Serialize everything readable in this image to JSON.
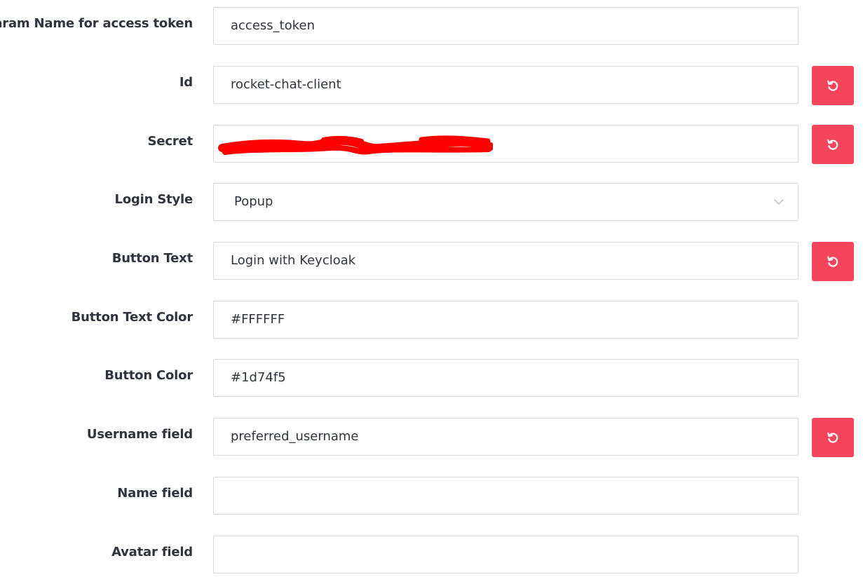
{
  "fields": {
    "param_name": {
      "label": "Param Name for access token",
      "value": "access_token"
    },
    "id": {
      "label": "Id",
      "value": "rocket-chat-client"
    },
    "secret": {
      "label": "Secret",
      "value": "",
      "redacted": true
    },
    "login_style": {
      "label": "Login Style",
      "value": "Popup"
    },
    "button_text": {
      "label": "Button Text",
      "value": "Login with Keycloak"
    },
    "button_text_color": {
      "label": "Button Text Color",
      "value": "#FFFFFF"
    },
    "button_color": {
      "label": "Button Color",
      "value": "#1d74f5"
    },
    "username_field": {
      "label": "Username field",
      "value": "preferred_username"
    },
    "name_field": {
      "label": "Name field",
      "value": ""
    },
    "avatar_field": {
      "label": "Avatar field",
      "value": ""
    }
  },
  "icons": {
    "reset": "undo-icon",
    "dropdown": "chevron-down-icon"
  },
  "colors": {
    "reset_button": "#f5455c",
    "label_text": "#2f343d",
    "field_border": "#d6d8dc",
    "redaction": "#ff0000"
  }
}
